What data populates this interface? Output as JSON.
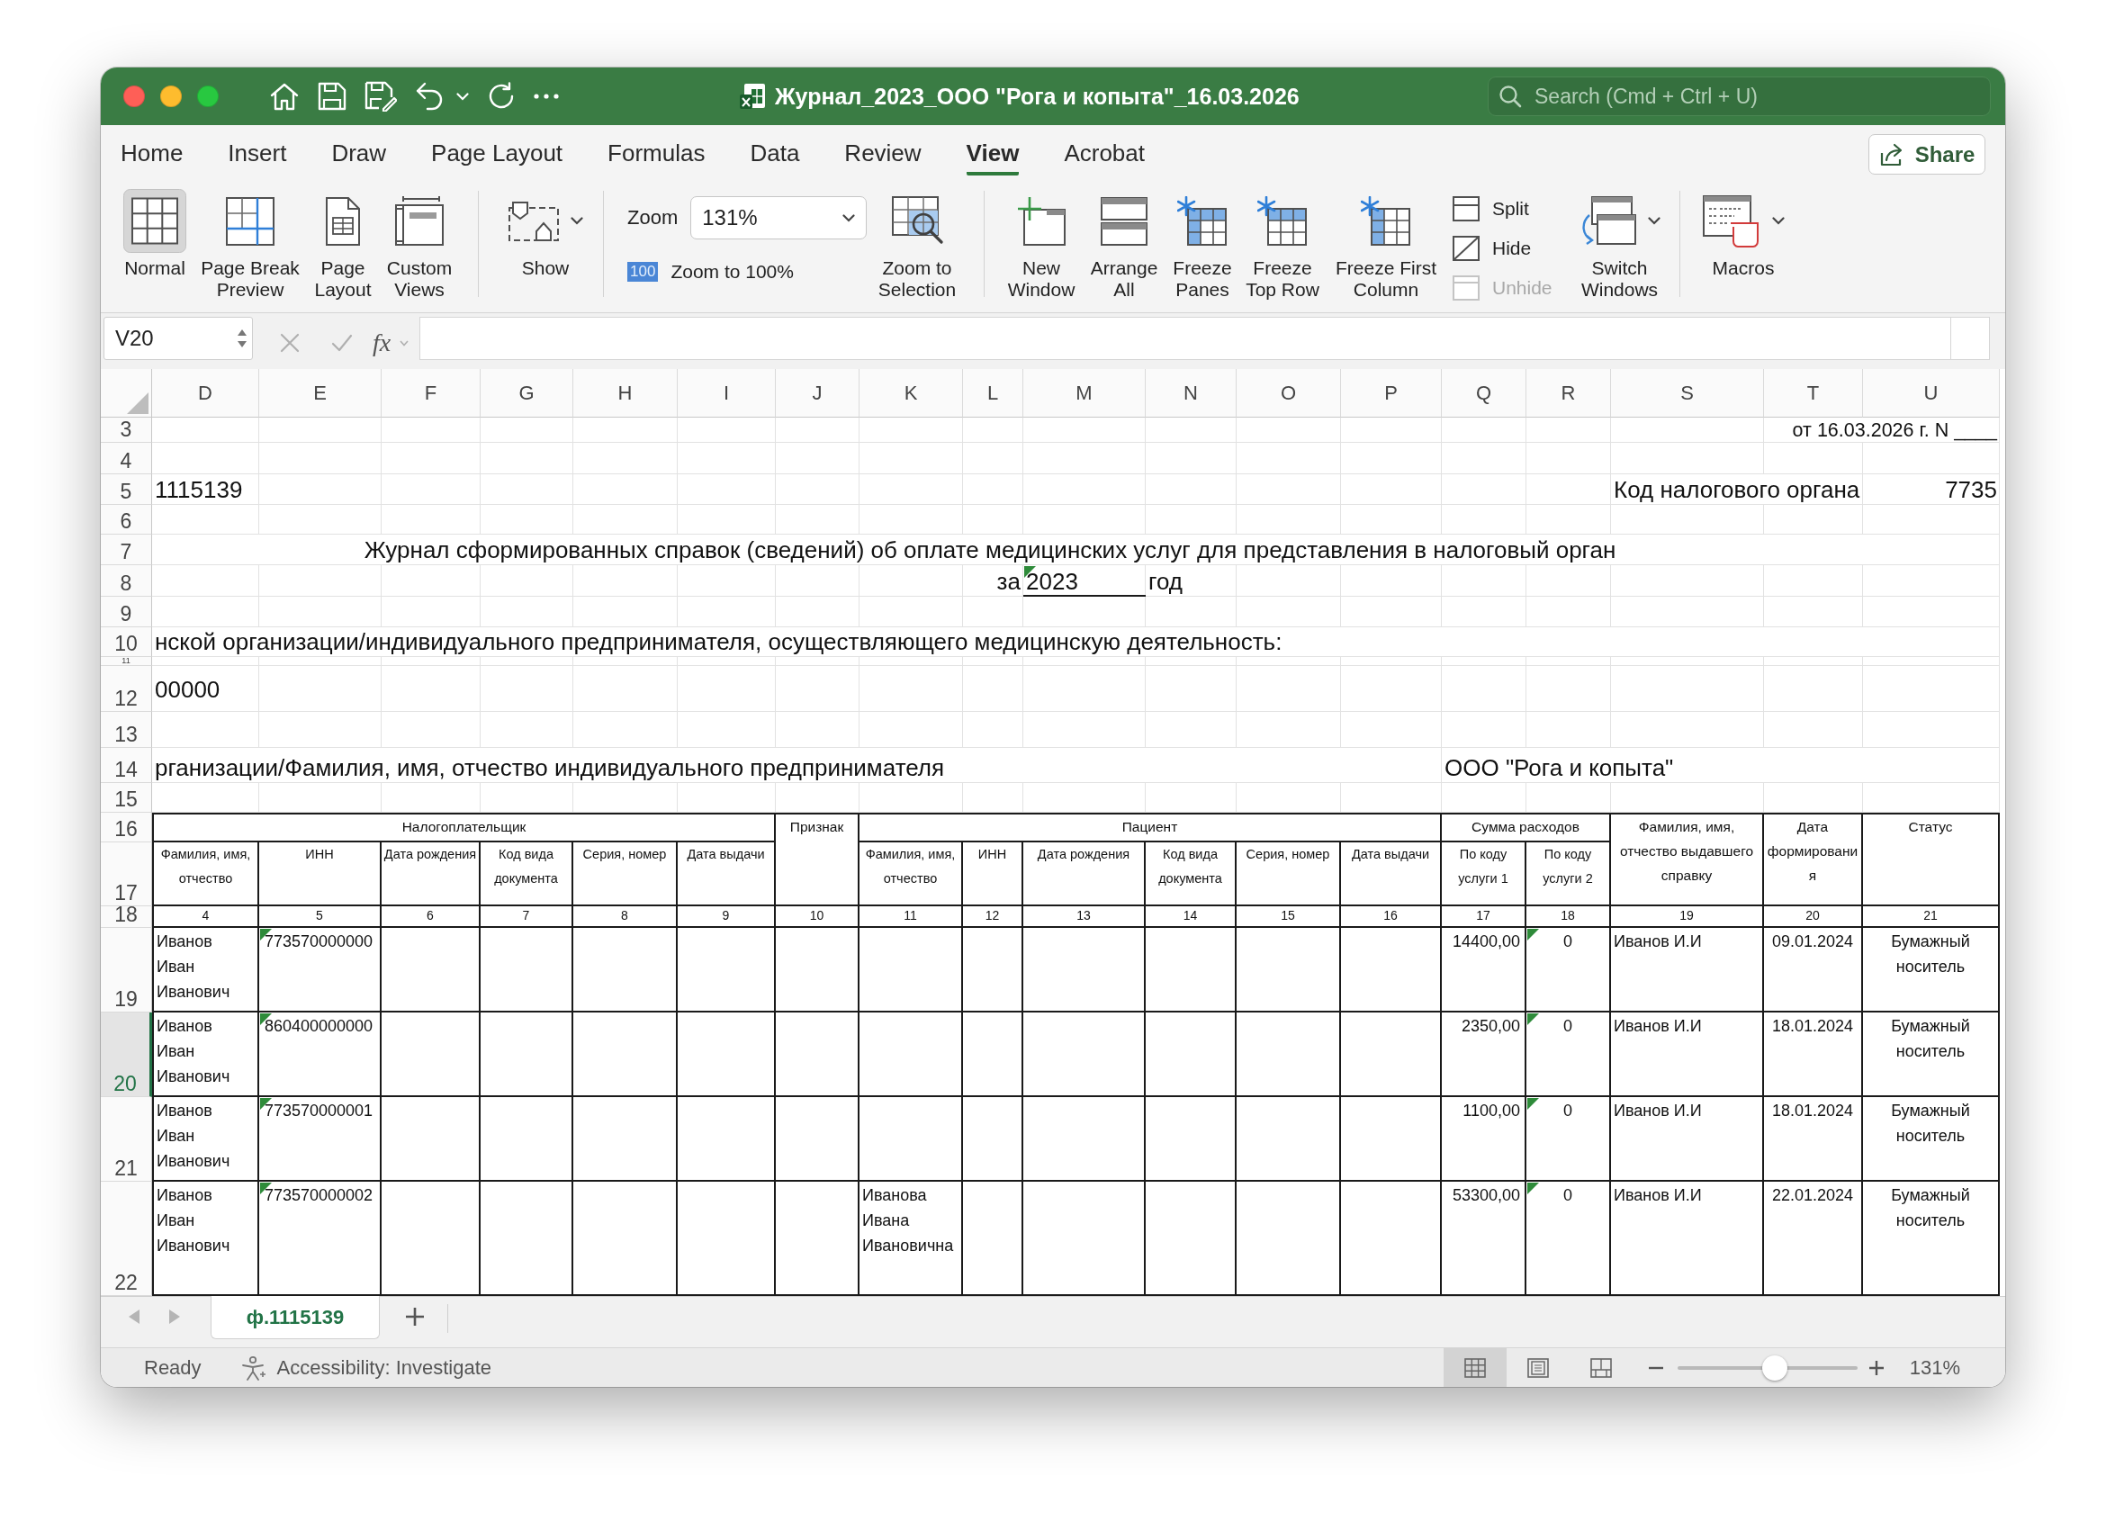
{
  "window": {
    "title": "Журнал_2023_ООО \"Рога и копыта\"_16.03.2026",
    "search": {
      "placeholder": "Search (Cmd + Ctrl + U)"
    }
  },
  "ribbon_tabs": [
    {
      "label": "Home",
      "selected": false
    },
    {
      "label": "Insert",
      "selected": false
    },
    {
      "label": "Draw",
      "selected": false
    },
    {
      "label": "Page Layout",
      "selected": false
    },
    {
      "label": "Formulas",
      "selected": false
    },
    {
      "label": "Data",
      "selected": false
    },
    {
      "label": "Review",
      "selected": false
    },
    {
      "label": "View",
      "selected": true
    },
    {
      "label": "Acrobat",
      "selected": false
    }
  ],
  "share_button": {
    "label": "Share"
  },
  "ribbon": {
    "view_buttons": [
      {
        "label": "Normal",
        "selected": true
      },
      {
        "label": "Page Break\nPreview",
        "selected": false
      },
      {
        "label": "Page\nLayout",
        "selected": false
      },
      {
        "label": "Custom\nViews",
        "selected": false
      }
    ],
    "show_button": {
      "label": "Show"
    },
    "zoom": {
      "label": "Zoom",
      "value": "131%",
      "reset_badge": "100",
      "reset_label": "Zoom to 100%"
    },
    "zoom_selection_button": {
      "label": "Zoom to\nSelection"
    },
    "window_buttons": [
      {
        "label": "New\nWindow"
      },
      {
        "label": "Arrange\nAll"
      },
      {
        "label": "Freeze\nPanes"
      },
      {
        "label": "Freeze\nTop Row"
      },
      {
        "label": "Freeze First\nColumn"
      }
    ],
    "pane_buttons": [
      {
        "label": "Split",
        "disabled": false
      },
      {
        "label": "Hide",
        "disabled": false
      },
      {
        "label": "Unhide",
        "disabled": true
      }
    ],
    "switch_windows_button": {
      "label": "Switch\nWindows"
    },
    "macros_button": {
      "label": "Macros"
    }
  },
  "formula_bar": {
    "name_box": "V20",
    "function_button": "fx"
  },
  "sheet": {
    "columns": [
      "D",
      "E",
      "F",
      "G",
      "H",
      "I",
      "J",
      "K",
      "L",
      "M",
      "N",
      "O",
      "P",
      "Q",
      "R",
      "S",
      "T",
      "U"
    ],
    "rows": [
      {
        "label": "3",
        "selected": false
      },
      {
        "label": "4",
        "selected": false
      },
      {
        "label": "5",
        "selected": false
      },
      {
        "label": "6",
        "selected": false
      },
      {
        "label": "7",
        "selected": false
      },
      {
        "label": "8",
        "selected": false
      },
      {
        "label": "9",
        "selected": false
      },
      {
        "label": "10",
        "selected": false
      },
      {
        "label": "11",
        "selected": false
      },
      {
        "label": "12",
        "selected": false
      },
      {
        "label": "13",
        "selected": false
      },
      {
        "label": "14",
        "selected": false
      },
      {
        "label": "15",
        "selected": false
      },
      {
        "label": "16",
        "selected": false
      },
      {
        "label": "17",
        "selected": false
      },
      {
        "label": "18",
        "selected": false
      },
      {
        "label": "19",
        "selected": false
      },
      {
        "label": "20",
        "selected": true
      },
      {
        "label": "21",
        "selected": false
      },
      {
        "label": "22",
        "selected": false
      }
    ],
    "form": {
      "document_number": "от 16.03.2026 г. N ____",
      "form_code": "1115139",
      "tax_office_label": "Код налогового органа",
      "tax_office_code": "7735",
      "title": "Журнал сформированных справок (сведений) об оплате медицинских услуг для представления в налоговый орган",
      "period_prefix": "за",
      "period_year": {
        "text": "2023",
        "warning": true
      },
      "period_suffix": "год",
      "organization_caption": "нской организации/индивидуального предпринимателя, осуществляющего медицинскую деятельность:",
      "organization_code": "00000",
      "name_caption": "рганизации/Фамилия, имя, отчество индивидуального предпринимателя",
      "name_value": "ООО \"Рога и копыта\""
    },
    "table": {
      "group_headers": [
        "Налогоплательщик",
        "Признак",
        "Пациент",
        "Сумма расходов",
        "Фамилия, имя,\nотчество выдавшего\nсправку",
        "Дата\nформировани\nя",
        "Статус"
      ],
      "column_headers": [
        "Фамилия, имя,\nотчество",
        "ИНН",
        "Дата рождения",
        "Код вида\nдокумента",
        "Серия, номер",
        "Дата выдачи",
        "Фамилия, имя,\nотчество",
        "ИНН",
        "Дата рождения",
        "Код вида\nдокумента",
        "Серия, номер",
        "Дата выдачи",
        "По коду\nуслуги 1",
        "По коду\nуслуги 2"
      ],
      "column_numbers": [
        "4",
        "5",
        "6",
        "7",
        "8",
        "9",
        "10",
        "11",
        "12",
        "13",
        "14",
        "15",
        "16",
        "17",
        "18",
        "19",
        "20",
        "21"
      ],
      "rows": [
        {
          "taxpayer_name": "Иванов\nИван\nИванович",
          "taxpayer_inn": {
            "text": "773570000000",
            "warning": true
          },
          "amount_1": "14400,00",
          "amount_2": {
            "text": "0",
            "warning": true
          },
          "issued_by": "Иванов И.И",
          "created": "09.01.2024",
          "status": "Бумажный\nноситель"
        },
        {
          "taxpayer_name": "Иванов\nИван\nИванович",
          "taxpayer_inn": {
            "text": "860400000000",
            "warning": true
          },
          "amount_1": "2350,00",
          "amount_2": {
            "text": "0",
            "warning": true
          },
          "issued_by": "Иванов И.И",
          "created": "18.01.2024",
          "status": "Бумажный\nноситель"
        },
        {
          "taxpayer_name": "Иванов\nИван\nИванович",
          "taxpayer_inn": {
            "text": "773570000001",
            "warning": true
          },
          "amount_1": "1100,00",
          "amount_2": {
            "text": "0",
            "warning": true
          },
          "issued_by": "Иванов И.И",
          "created": "18.01.2024",
          "status": "Бумажный\nноситель"
        },
        {
          "taxpayer_name": "Иванов\nИван\nИванович",
          "taxpayer_inn": {
            "text": "773570000002",
            "warning": true
          },
          "patient_name": "Иванова\nИвана\nИвановична",
          "amount_1": "53300,00",
          "amount_2": {
            "text": "0",
            "warning": true
          },
          "issued_by": "Иванов И.И",
          "created": "22.01.2024",
          "status": "Бумажный\nноситель"
        }
      ]
    }
  },
  "sheet_tabs": [
    {
      "label": "ф.1115139",
      "selected": true
    }
  ],
  "status_bar": {
    "status": "Ready",
    "accessibility": "Accessibility: Investigate",
    "view_buttons": [
      {
        "selected": true
      },
      {
        "selected": false
      },
      {
        "selected": false
      }
    ],
    "zoom_slider": {
      "level": 0.54
    },
    "zoom": "131%"
  }
}
